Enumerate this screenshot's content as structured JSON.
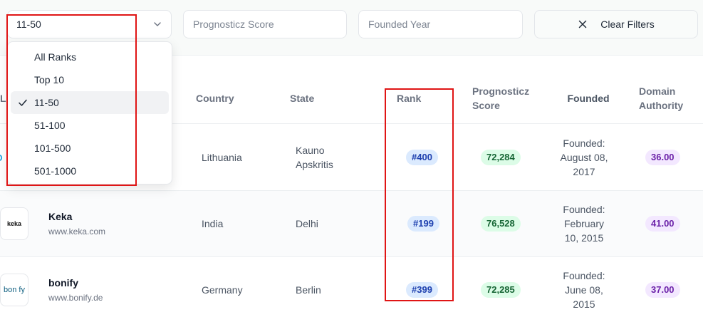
{
  "filters": {
    "rank_selected": "11-50",
    "prognosticz_placeholder": "Prognosticz Score",
    "founded_placeholder": "Founded Year",
    "clear_label": "Clear Filters"
  },
  "rank_dropdown": {
    "options": [
      "All Ranks",
      "Top 10",
      "11-50",
      "51-100",
      "101-500",
      "501-1000"
    ],
    "selected_index": 2
  },
  "table": {
    "headers": {
      "partial": "L",
      "country": "Country",
      "state": "State",
      "rank": "Rank",
      "score_line1": "Prognosticz",
      "score_line2": "Score",
      "founded": "Founded",
      "da_line1": "Domain",
      "da_line2": "Authority"
    },
    "rows": [
      {
        "logo_text": "D",
        "name": "",
        "domain": "",
        "country": "Lithuania",
        "state_line1": "Kauno",
        "state_line2": "Apskritis",
        "rank": "#400",
        "score": "72,284",
        "founded_line1": "Founded:",
        "founded_line2": "August 08,",
        "founded_line3": "2017",
        "da": "36.00"
      },
      {
        "logo_text": "keka",
        "name": "Keka",
        "domain": "www.keka.com",
        "country": "India",
        "state_line1": "Delhi",
        "state_line2": "",
        "rank": "#199",
        "score": "76,528",
        "founded_line1": "Founded:",
        "founded_line2": "February",
        "founded_line3": "10, 2015",
        "da": "41.00"
      },
      {
        "logo_text": "bon fy",
        "name": "bonify",
        "domain": "www.bonify.de",
        "country": "Germany",
        "state_line1": "Berlin",
        "state_line2": "",
        "rank": "#399",
        "score": "72,285",
        "founded_line1": "Founded:",
        "founded_line2": "June 08,",
        "founded_line3": "2015",
        "da": "37.00"
      }
    ]
  },
  "colors": {
    "highlight": "#e01515",
    "rank_badge_bg": "#dbeafe",
    "score_badge_bg": "#dcfce7",
    "da_badge_bg": "#f3e8ff"
  }
}
